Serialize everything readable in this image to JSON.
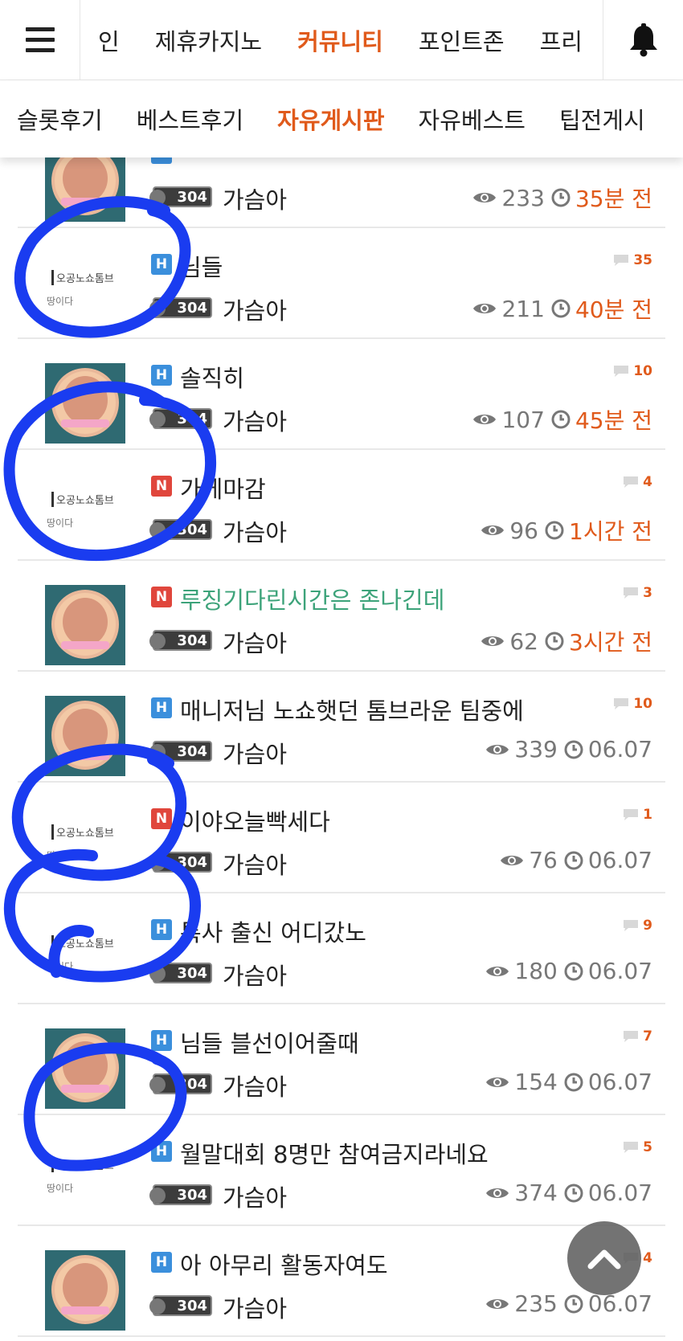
{
  "top_nav": {
    "items": [
      "인",
      "제휴카지노",
      "커뮤니티",
      "포인트존",
      "프리"
    ],
    "active_index": 2,
    "menu_icon": "hamburger-menu-icon",
    "bell_icon": "bell-icon"
  },
  "sub_nav": {
    "items": [
      "슬롯후기",
      "베스트후기",
      "자유게시판",
      "자유베스트",
      "팁전게시"
    ],
    "active_index": 2
  },
  "posts": [
    {
      "badge": "H",
      "title": "",
      "comments": "",
      "author": "가슴아",
      "level": "304",
      "views": "233",
      "time": "35분 전",
      "recent": true,
      "thumb": "a"
    },
    {
      "badge": "H",
      "title": "님들",
      "comments": "35",
      "author": "가슴아",
      "level": "304",
      "views": "211",
      "time": "40분 전",
      "recent": true,
      "thumb": "b"
    },
    {
      "badge": "H",
      "title": "솔직히",
      "comments": "10",
      "author": "가슴아",
      "level": "304",
      "views": "107",
      "time": "45분 전",
      "recent": true,
      "thumb": "a"
    },
    {
      "badge": "N",
      "title": "가게마감",
      "comments": "4",
      "author": "가슴아",
      "level": "304",
      "views": "96",
      "time": "1시간 전",
      "recent": true,
      "thumb": "b"
    },
    {
      "badge": "N",
      "title": "루징기다린시간은 존나긴데",
      "comments": "3",
      "author": "가슴아",
      "level": "304",
      "views": "62",
      "time": "3시간 전",
      "recent": true,
      "thumb": "a",
      "green": true
    },
    {
      "badge": "H",
      "title": "매니저님 노쇼햇던 톰브라운 팀중에",
      "comments": "10",
      "author": "가슴아",
      "level": "304",
      "views": "339",
      "time": "06.07",
      "recent": false,
      "thumb": "a"
    },
    {
      "badge": "N",
      "title": "이야오늘빡세다",
      "comments": "1",
      "author": "가슴아",
      "level": "304",
      "views": "76",
      "time": "06.07",
      "recent": false,
      "thumb": "b"
    },
    {
      "badge": "H",
      "title": "톡사 출신 어디갔노",
      "comments": "9",
      "author": "가슴아",
      "level": "304",
      "views": "180",
      "time": "06.07",
      "recent": false,
      "thumb": "b"
    },
    {
      "badge": "H",
      "title": "님들 블선이어줄때",
      "comments": "7",
      "author": "가슴아",
      "level": "304",
      "views": "154",
      "time": "06.07",
      "recent": false,
      "thumb": "a"
    },
    {
      "badge": "H",
      "title": "월말대회 8명만 참여금지라네요",
      "comments": "5",
      "author": "가슴아",
      "level": "304",
      "views": "374",
      "time": "06.07",
      "recent": false,
      "thumb": "b"
    },
    {
      "badge": "H",
      "title": "아 아무리 활동자여도",
      "comments": "4",
      "author": "가슴아",
      "level": "304",
      "views": "235",
      "time": "06.07",
      "recent": false,
      "thumb": "a"
    }
  ],
  "thumb_text": {
    "line1": "오공노쇼톰브",
    "line2": "땅이다"
  },
  "colors": {
    "accent": "#e05a1b",
    "badge_h": "#3b8fdc",
    "badge_n": "#e0463c",
    "marker": "#1a3cf0"
  }
}
